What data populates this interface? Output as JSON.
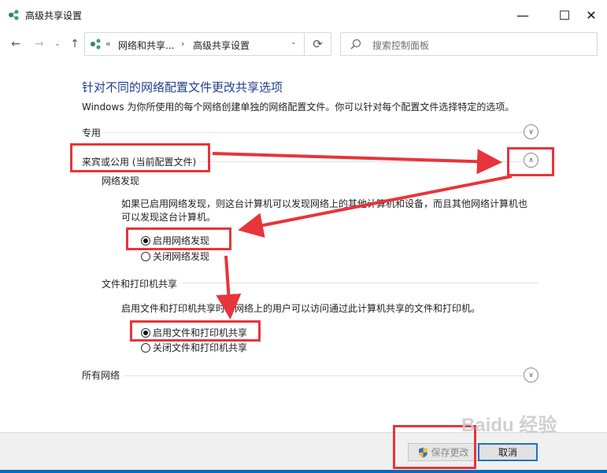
{
  "window": {
    "title": "高级共享设置",
    "minimize": "—",
    "maximize": "☐",
    "close": "✕"
  },
  "nav": {
    "back": "←",
    "forward": "→",
    "dropdown": "⌄",
    "up": "↑",
    "breadcrumb": {
      "sep": "«",
      "items": [
        "网络和共享...",
        "高级共享设置"
      ],
      "arrow": "›",
      "dropdown": "⌄"
    },
    "refresh": "⟳",
    "search_placeholder": "搜索控制面板"
  },
  "page": {
    "heading": "针对不同的网络配置文件更改共享选项",
    "description": "Windows 为你所使用的每个网络创建单独的网络配置文件。你可以针对每个配置文件选择特定的选项。"
  },
  "sections": {
    "private": {
      "label": "专用",
      "chevron": "∨"
    },
    "guest_public": {
      "label": "来宾或公用 (当前配置文件)",
      "chevron": "∧"
    },
    "all_networks": {
      "label": "所有网络",
      "chevron": "∨"
    }
  },
  "network_discovery": {
    "title": "网络发现",
    "line1": "如果已启用网络发现，则这台计算机可以发现网络上的其他计算机和设备，而且其他网络计算机也",
    "line2": "可以发现这台计算机。",
    "options": [
      {
        "label": "启用网络发现",
        "selected": true
      },
      {
        "label": "关闭网络发现",
        "selected": false
      }
    ]
  },
  "file_printer_sharing": {
    "title": "文件和打印机共享",
    "description": "启用文件和打印机共享时，网络上的用户可以访问通过此计算机共享的文件和打印机。",
    "options": [
      {
        "label": "启用文件和打印机共享",
        "selected": true
      },
      {
        "label": "关闭文件和打印机共享",
        "selected": false
      }
    ]
  },
  "footer": {
    "save_label": "保存更改",
    "cancel_label": "取消"
  },
  "watermark": "Baidu 经验",
  "colors": {
    "heading": "#1e3f8f",
    "annotation": "#e8343b",
    "taskbar": "#0a6ab8"
  }
}
